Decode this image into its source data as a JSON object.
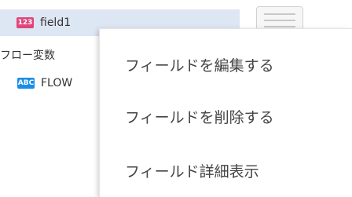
{
  "tree": {
    "field_row": {
      "type_badge": "123",
      "label": "field1"
    },
    "section_label": "フロー変数",
    "flow_row": {
      "type_badge": "ABC",
      "label": "FLOW"
    }
  },
  "context_menu": {
    "items": [
      {
        "label": "フィールドを編集する"
      },
      {
        "label": "フィールドを削除する"
      },
      {
        "label": "フィールド詳細表示"
      }
    ]
  },
  "colors": {
    "selected_row_bg": "#dde6f3",
    "number_badge": "#e0457b",
    "text_badge": "#1a8ee6"
  },
  "icons": {
    "panel": "document-panel-icon"
  }
}
